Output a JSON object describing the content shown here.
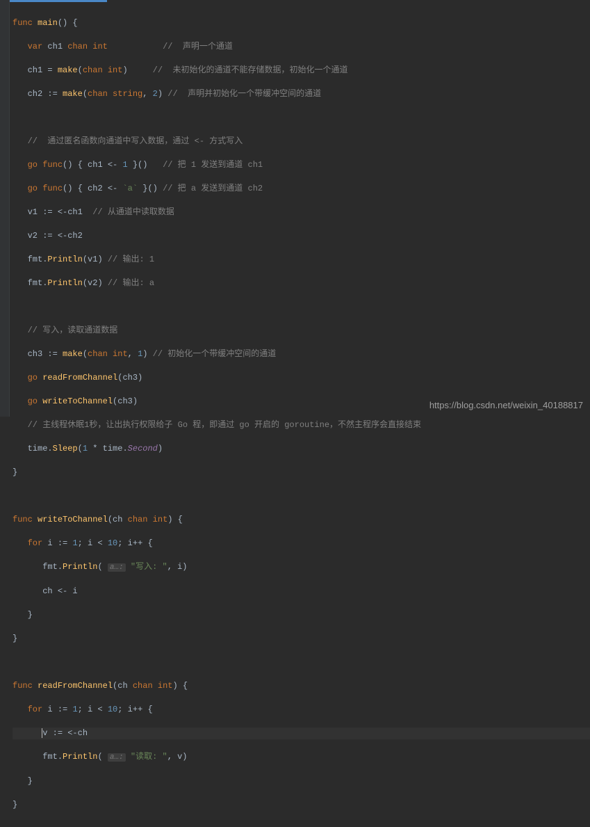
{
  "code": {
    "main": {
      "sig_func": "func",
      "sig_name": "main",
      "sig_rest": "() {",
      "l_var": "var",
      "l_ch1": "ch1",
      "l_chan_int": "chan int",
      "c_decl": "//  声明一个通道",
      "l_ch1_assign": "ch1 = ",
      "l_make": "make",
      "l_make_chan_int": "chan int",
      "c_uninit": "//  未初始化的通道不能存储数据，初始化一个通道",
      "l_ch2": "ch2 := ",
      "l_make2": "make",
      "l_chan_string": "chan string",
      "l_two": "2",
      "c_buffered": "//  声明并初始化一个带缓冲空间的通道",
      "c_anon": "//  通过匿名函数向通道中写入数据，通过 <- 方式写入",
      "l_go": "go",
      "l_func": "func",
      "l_gofunc1_body": "() { ch1 <- ",
      "l_one": "1",
      "l_gofunc1_end": " }()",
      "c_send1": "// 把 1 发送到通道 ch1",
      "l_gofunc2_body": "() { ch2 <- ",
      "l_str_a": "`a`",
      "l_gofunc2_end": " }()",
      "c_senda": "// 把 a 发送到通道 ch2",
      "l_v1": "v1 := <-ch1",
      "c_read": "// 从通道中读取数据",
      "l_v2": "v2 := <-ch2",
      "l_fmt": "fmt",
      "l_println": "Println",
      "l_v1_arg": "(v1)",
      "c_out1": "// 输出: 1",
      "l_v2_arg": "(v2)",
      "c_outa": "// 输出: a",
      "c_rw": "// 写入，读取通道数据",
      "l_ch3": "ch3 := ",
      "l_make3": "make",
      "l_chan_int3": "chan int",
      "l_one3": "1",
      "c_buf1": "// 初始化一个带缓冲空间的通道",
      "l_readFrom": "readFromChannel",
      "l_ch3arg": "(ch3)",
      "l_writeTo": "writeToChannel",
      "c_sleep": "// 主线程休眠1秒，让出执行权限给子 Go 程，即通过 go 开启的 goroutine，不然主程序会直接结束",
      "l_time": "time",
      "l_sleep": "Sleep",
      "l_sleep_arg_open": "(",
      "l_sleep_one": "1",
      "l_sleep_mul": " * ",
      "l_time2": "time",
      "l_second": "Second",
      "l_sleep_close": ")",
      "l_close": "}"
    },
    "writeTo": {
      "sig_func": "func",
      "sig_name": "writeToChannel",
      "sig_params_open": "(ch ",
      "sig_chan_int": "chan int",
      "sig_params_close": ") {",
      "for_kw": "for",
      "for_init": " i := ",
      "for_1": "1",
      "for_cond": "; i < ",
      "for_10": "10",
      "for_post": "; i++ {",
      "fmt": "fmt",
      "println": "Println",
      "hint": "a…:",
      "str_write": "\"写入: \"",
      "args_close": ", i)",
      "ch_send": "ch <- i",
      "brace": "}"
    },
    "readFrom": {
      "sig_func": "func",
      "sig_name": "readFromChannel",
      "sig_params_open": "(ch ",
      "sig_chan_int": "chan int",
      "sig_params_close": ") {",
      "for_kw": "for",
      "for_init": " i := ",
      "for_1": "1",
      "for_cond": "; i < ",
      "for_10": "10",
      "for_post": "; i++ {",
      "v_recv": "v := <-ch",
      "fmt": "fmt",
      "println": "Println",
      "hint": "a…:",
      "str_read": "\"读取: \"",
      "args_close": ", v)",
      "brace": "}"
    }
  },
  "watermark": "https://blog.csdn.net/weixin_40188817"
}
